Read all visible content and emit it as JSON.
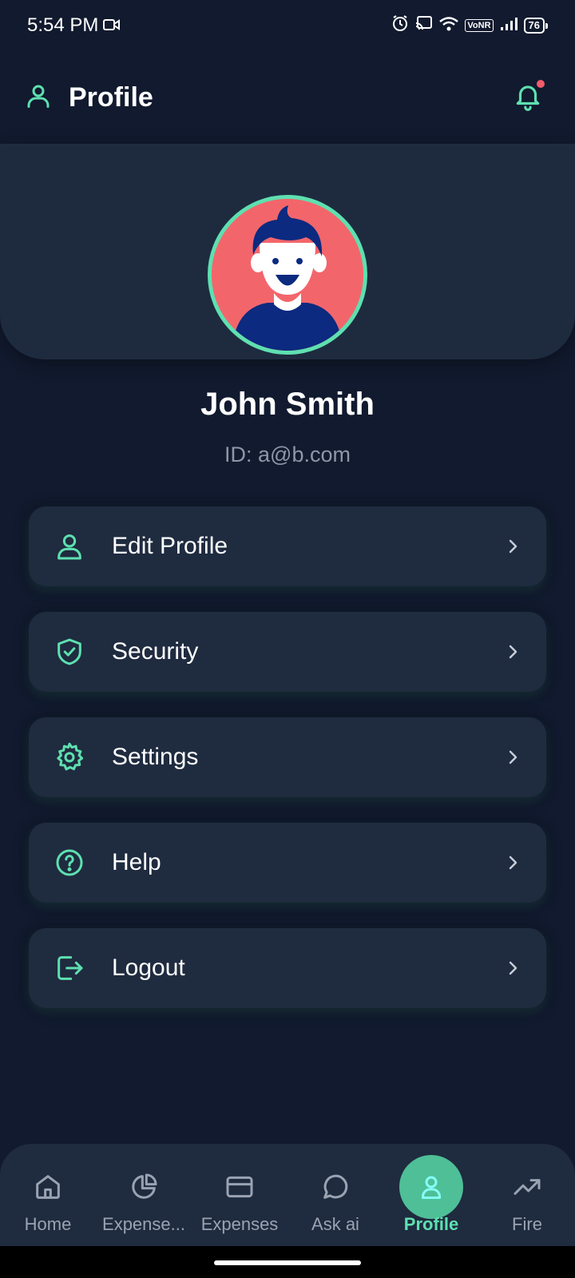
{
  "status_bar": {
    "time": "5:54 PM",
    "network": "VoNR",
    "battery": "76"
  },
  "header": {
    "title": "Profile"
  },
  "profile": {
    "name": "John Smith",
    "id_text": "ID: a@b.com"
  },
  "menu": [
    {
      "label": "Edit Profile",
      "icon": "user-icon"
    },
    {
      "label": "Security",
      "icon": "shield-check-icon"
    },
    {
      "label": "Settings",
      "icon": "gear-icon"
    },
    {
      "label": "Help",
      "icon": "help-circle-icon"
    },
    {
      "label": "Logout",
      "icon": "logout-icon"
    }
  ],
  "nav": [
    {
      "label": "Home",
      "icon": "home-icon",
      "active": false
    },
    {
      "label": "Expense...",
      "icon": "pie-chart-icon",
      "active": false
    },
    {
      "label": "Expenses",
      "icon": "credit-card-icon",
      "active": false
    },
    {
      "label": "Ask ai",
      "icon": "chat-icon",
      "active": false
    },
    {
      "label": "Profile",
      "icon": "user-icon",
      "active": true
    },
    {
      "label": "Fire",
      "icon": "trending-up-icon",
      "active": false
    }
  ],
  "colors": {
    "accent": "#5ee0b0",
    "background": "#111a2e",
    "card": "#1f2b3f",
    "notification_dot": "#f25c6b",
    "avatar_bg": "#f2666b"
  }
}
